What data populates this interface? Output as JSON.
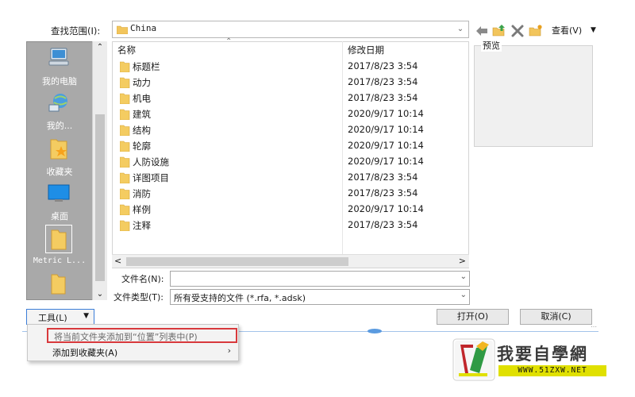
{
  "look_in": {
    "label": "查找范围(I):",
    "value": "China"
  },
  "views": {
    "label": "查看(V)"
  },
  "places": [
    {
      "label": "我的电脑",
      "icon": "computer-icon"
    },
    {
      "label": "我的...",
      "icon": "network-icon"
    },
    {
      "label": "收藏夹",
      "icon": "favorites-icon"
    },
    {
      "label": "桌面",
      "icon": "desktop-icon"
    },
    {
      "label": "Metric L...",
      "icon": "folder-icon"
    },
    {
      "label": "",
      "icon": "folder-icon"
    }
  ],
  "file_list": {
    "columns": {
      "name": "名称",
      "modified": "修改日期"
    },
    "rows": [
      {
        "name": "标题栏",
        "modified": "2017/8/23 3:54"
      },
      {
        "name": "动力",
        "modified": "2017/8/23 3:54"
      },
      {
        "name": "机电",
        "modified": "2017/8/23 3:54"
      },
      {
        "name": "建筑",
        "modified": "2020/9/17 10:14"
      },
      {
        "name": "结构",
        "modified": "2020/9/17 10:14"
      },
      {
        "name": "轮廓",
        "modified": "2020/9/17 10:14"
      },
      {
        "name": "人防设施",
        "modified": "2020/9/17 10:14"
      },
      {
        "name": "详图项目",
        "modified": "2017/8/23 3:54"
      },
      {
        "name": "消防",
        "modified": "2017/8/23 3:54"
      },
      {
        "name": "样例",
        "modified": "2020/9/17 10:14"
      },
      {
        "name": "注释",
        "modified": "2017/8/23 3:54"
      }
    ]
  },
  "preview": {
    "label": "预览"
  },
  "file_name": {
    "label": "文件名(N):",
    "value": ""
  },
  "file_type": {
    "label": "文件类型(T):",
    "value": "所有受支持的文件 (*.rfa, *.adsk)"
  },
  "buttons": {
    "tools": "工具(L)",
    "open": "打开(O)",
    "cancel": "取消(C)"
  },
  "tools_menu": {
    "items": [
      {
        "label": "将当前文件夹添加到“位置”列表中(P)",
        "enabled": false
      },
      {
        "label": "添加到收藏夹(A)",
        "enabled": true,
        "submenu": true
      }
    ]
  },
  "watermark": {
    "title": "我要自學網",
    "url": "WWW.51ZXW.NET"
  },
  "colors": {
    "folder": "#f2c55c",
    "places_bg": "#a9a9a9",
    "highlight_border": "#d8393c",
    "logo_yellow": "#e0e000"
  }
}
